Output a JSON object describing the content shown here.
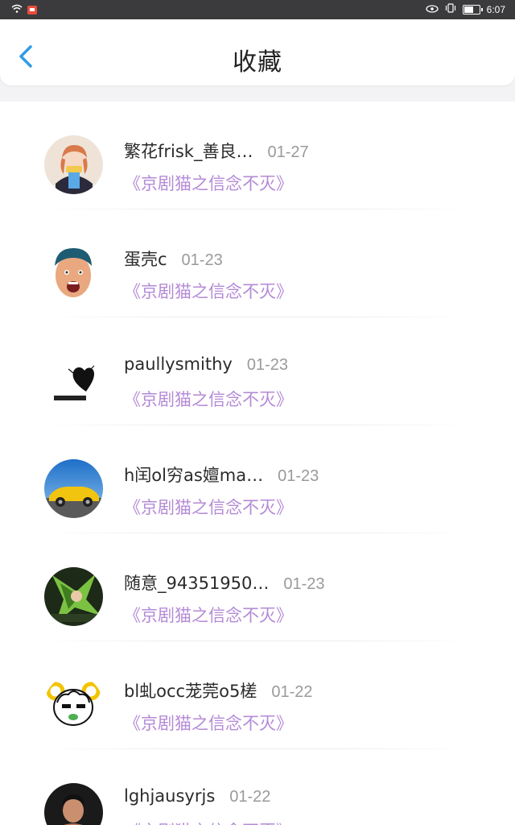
{
  "status_bar": {
    "time": "6:07",
    "battery_label": "67",
    "battery_level": 0.67
  },
  "header": {
    "title": "收藏"
  },
  "items": [
    {
      "username": "繁花frisk_善良…",
      "date": "01-27",
      "work": "《京剧猫之信念不灭》",
      "avatar_icon": "avatar-anime-girl-icon"
    },
    {
      "username": "蛋壳c",
      "date": "01-23",
      "work": "《京剧猫之信念不灭》",
      "avatar_icon": "avatar-man-face-icon"
    },
    {
      "username": "paullysmithy",
      "date": "01-23",
      "work": "《京剧猫之信念不灭》",
      "avatar_icon": "avatar-black-heart-icon"
    },
    {
      "username": "h闰ol穷as嬗ma…",
      "date": "01-23",
      "work": "《京剧猫之信念不灭》",
      "avatar_icon": "avatar-yellow-car-icon"
    },
    {
      "username": "随意_94351950…",
      "date": "01-23",
      "work": "《京剧猫之信念不灭》",
      "avatar_icon": "avatar-green-anime-icon"
    },
    {
      "username": "bl虬occ茏莞o5槎",
      "date": "01-22",
      "work": "《京剧猫之信念不灭》",
      "avatar_icon": "avatar-sheep-icon"
    },
    {
      "username": "lghjausyrjs",
      "date": "01-22",
      "work": "《京剧猫之信念不灭》",
      "avatar_icon": "avatar-boxer-icon"
    }
  ]
}
